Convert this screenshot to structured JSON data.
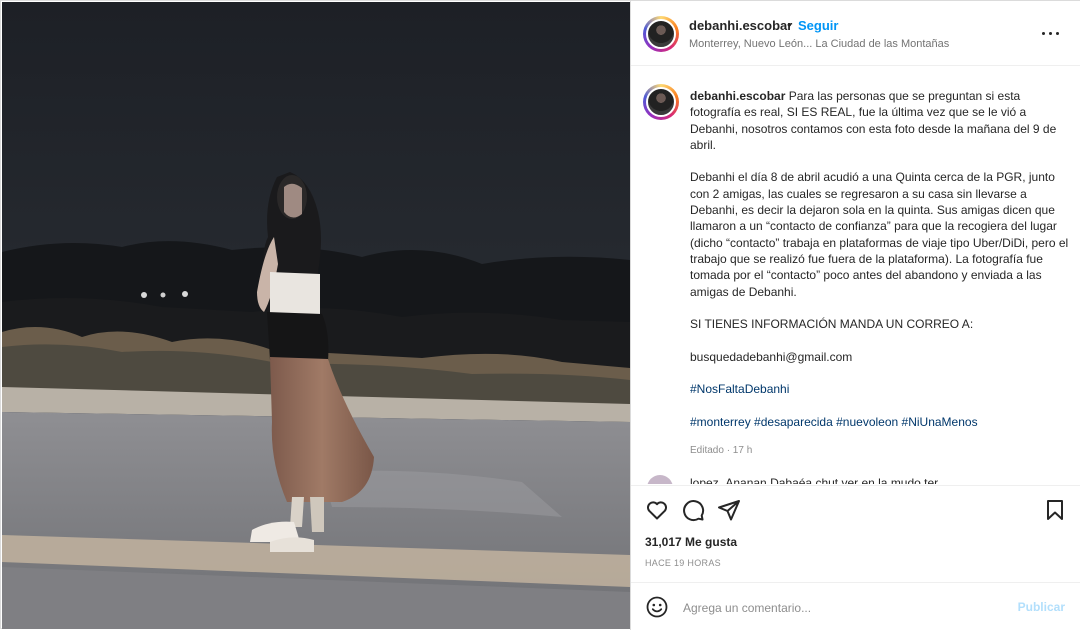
{
  "post": {
    "username": "debanhi.escobar",
    "follow_label": "Seguir",
    "location": "Monterrey, Nuevo León... La Ciudad de las Montañas",
    "caption": {
      "username": "debanhi.escobar",
      "p1_text": "Para las personas que se preguntan si esta fotografía es real, SI ES REAL, fue la última vez que se le vió a Debanhi, nosotros contamos con esta foto desde la mañana del 9 de abril.",
      "p2": "Debanhi el día 8 de abril acudió a una Quinta cerca de la PGR, junto con 2 amigas, las cuales se regresaron a su casa sin llevarse a Debanhi, es decir la dejaron sola en la quinta. Sus amigas dicen que llamaron a un “contacto de confianza” para que la recogiera del lugar (dicho “contacto” trabaja en plataformas de viaje tipo Uber/DiDi, pero el trabajo que se realizó fue fuera de la plataforma). La fotografía fue tomada por el “contacto” poco antes del abandono y enviada a las amigas de Debanhi.",
      "p3": "SI TIENES INFORMACIÓN MANDA UN CORREO A:",
      "email": "busquedadebanhi@gmail.com",
      "hashtag1": "#NosFaltaDebanhi",
      "tags": [
        "#monterrey",
        "#desaparecida",
        "#nuevoleon",
        "#NiUnaMenos"
      ],
      "edited": "Editado · 17 h"
    },
    "next_comment_peek": "lopez_Ananan  Dabaéa chut ver en la mudo ter",
    "likes": "31,017 Me gusta",
    "timestamp": "HACE 19 HORAS",
    "comment_placeholder": "Agrega un comentario...",
    "publish_label": "Publicar",
    "icons": [
      "more-options-icon",
      "heart-icon",
      "comment-icon",
      "share-icon",
      "bookmark-icon",
      "emoji-icon"
    ],
    "colors": {
      "link": "#0095f6",
      "hashtag": "#00376b",
      "publish_disabled": "#b2dffc",
      "muted": "#8e8e8e"
    }
  }
}
